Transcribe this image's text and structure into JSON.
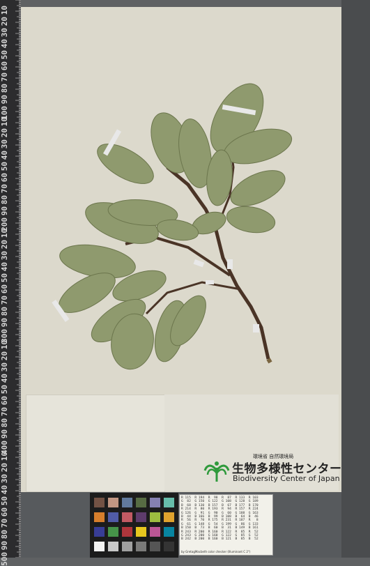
{
  "ruler": {
    "labels": [
      "10",
      "20",
      "30",
      "40",
      "50",
      "60",
      "70",
      "80",
      "90",
      "100",
      "10",
      "20",
      "30",
      "40",
      "50",
      "60",
      "70",
      "80",
      "90",
      "200",
      "10",
      "20",
      "30",
      "40",
      "50",
      "60",
      "70",
      "80",
      "90",
      "300",
      "10",
      "20",
      "30",
      "40",
      "50",
      "60",
      "70",
      "80",
      "90",
      "400",
      "10",
      "20",
      "30",
      "40",
      "50",
      "60",
      "70",
      "80",
      "90",
      "500"
    ]
  },
  "institution": {
    "ministry": "環境省 自然環境局",
    "name_jp": "生物多様性センター",
    "name_en": "Biodiversity Center of Japan"
  },
  "color_checker": {
    "patches": [
      "#735244",
      "#c29682",
      "#627a9d",
      "#576c43",
      "#8580b1",
      "#67bdaa",
      "#d67e2c",
      "#505ba6",
      "#c15a63",
      "#5e3c6c",
      "#9dbc40",
      "#e0a32e",
      "#383d96",
      "#469449",
      "#af363c",
      "#e7c71f",
      "#bb5695",
      "#0885a1",
      "#f3f3f2",
      "#c8c8c8",
      "#a0a0a0",
      "#7a7a79",
      "#555555",
      "#343434"
    ],
    "values_text": "R 115  R 194  R  98  R  87  R 133  R 103\nG  82  G 150  G 122  G 108  G 128  G 189\nB  68  B 130  B 157  B  67  B 177  B 170\nR 214  R  80  R 193  R  94  R 157  R 224\nG 126  G  91  G  90  G  60  G 188  G 163\nB  44  B 166  B  99  B 108  B  64  B  46\nR  56  R  70  R 175  R 231  R 187  R   8\nG  61  G 148  G  54  G 199  G  86  G 133\nB 150  B  73  B  60  B  31  B 149  B 161\nR 243  R 200  R 160  R 122  R  85  R  52\nG 243  G 200  G 160  G 122  G  85  G  52\nB 242  B 200  B 160  B 121  B  85  B  52",
    "caption": "by GretagMacbeth color checker (Illuminant C 2°)"
  },
  "colors": {
    "sheet": "#dcd9cc",
    "leaf": "#8f9a6e",
    "leaf_dark": "#6f7a50",
    "stem": "#4a3426",
    "logo_green": "#2f9a3c"
  }
}
